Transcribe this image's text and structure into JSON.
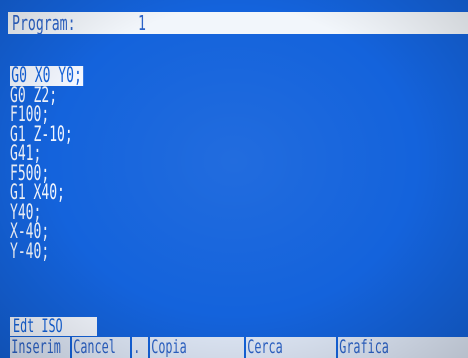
{
  "header": {
    "label": "Program:",
    "value": "1"
  },
  "code_lines": [
    {
      "text": "G0 X0 Y0;",
      "selected": true
    },
    {
      "text": "G0 Z2;",
      "selected": false
    },
    {
      "text": "F100;",
      "selected": false
    },
    {
      "text": "G1 Z-10;",
      "selected": false
    },
    {
      "text": "G41;",
      "selected": false
    },
    {
      "text": "F500;",
      "selected": false
    },
    {
      "text": "G1 X40;",
      "selected": false
    },
    {
      "text": "Y40;",
      "selected": false
    },
    {
      "text": "X-40;",
      "selected": false
    },
    {
      "text": "Y-40;",
      "selected": false
    }
  ],
  "mode_label": "Edt ISO",
  "function_keys": [
    {
      "label": "Inserim"
    },
    {
      "label": "Cancel"
    },
    {
      "label": "."
    },
    {
      "label": "Copia"
    },
    {
      "label": "Cerca"
    },
    {
      "label": "Grafica"
    }
  ],
  "colors": {
    "screen_bg": "#1463dc",
    "text": "#f3f7ff",
    "highlight_bg": "#f3f7ff"
  }
}
